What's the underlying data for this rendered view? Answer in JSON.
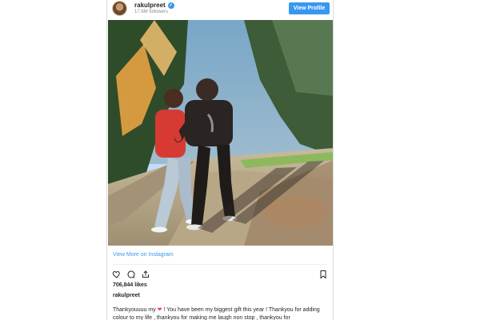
{
  "header": {
    "username": "rakulpreet",
    "followers": "17.6M followers",
    "view_profile": "View Profile"
  },
  "post": {
    "image_alt": "Two people walking hand in hand on a sunlit tree-lined path",
    "view_more": "View More on Instagram",
    "likes": "706,844 likes",
    "caption_user": "rakulpreet",
    "caption_before": "Thankyouuuu my",
    "caption_heart": "❤",
    "caption_after": "! You have been my biggest gift this year ! Thankyou for adding colour to my life , thankyou for making me laugh non stop , thankyou for"
  },
  "icons": {
    "verified": "verified-badge-icon",
    "like": "heart-icon",
    "comment": "comment-icon",
    "share": "share-icon",
    "save": "bookmark-icon"
  },
  "colors": {
    "accent": "#3897f0",
    "heart": "#ed4956",
    "text": "#262626",
    "muted": "#8e8e8e"
  }
}
